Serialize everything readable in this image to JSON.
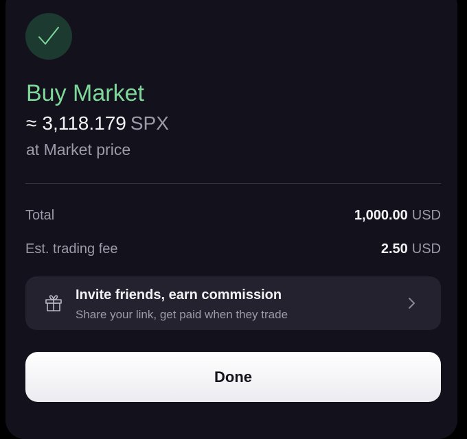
{
  "order": {
    "status_icon": "checkmark-icon",
    "title": "Buy Market",
    "approx_symbol": "≈",
    "amount_value": "3,118.179",
    "amount_unit": "SPX",
    "price_note": "at Market price"
  },
  "summary": {
    "total_label": "Total",
    "total_value": "1,000.00",
    "total_unit": "USD",
    "fee_label": "Est. trading fee",
    "fee_value": "2.50",
    "fee_unit": "USD"
  },
  "invite": {
    "icon": "gift-icon",
    "title": "Invite friends, earn commission",
    "subtitle": "Share your link, get paid when they trade",
    "chevron": "chevron-right-icon"
  },
  "actions": {
    "done_label": "Done"
  },
  "colors": {
    "accent_green": "#7ed89a",
    "sheet_background": "#13121c",
    "card_background": "#23222e"
  }
}
